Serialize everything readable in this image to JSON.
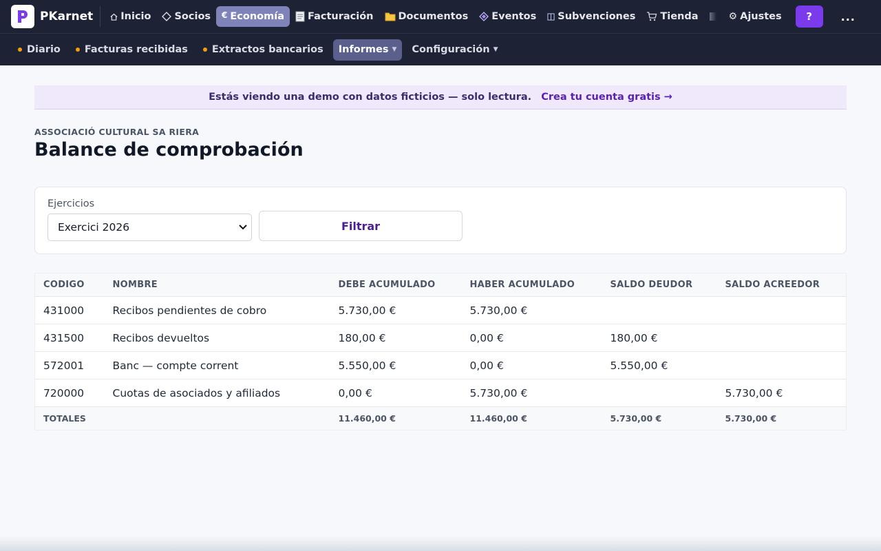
{
  "app": {
    "name": "PKarnet"
  },
  "nav": {
    "items": [
      {
        "label": "Inicio",
        "icon": "home-icon"
      },
      {
        "label": "Socios",
        "icon": "diamond-icon"
      },
      {
        "label": "Economía",
        "icon": "euro-icon",
        "active": true
      },
      {
        "label": "Facturación",
        "icon": "invoice-icon"
      },
      {
        "label": "Documentos",
        "icon": "folder-icon"
      },
      {
        "label": "Eventos",
        "icon": "event-diamond-icon"
      },
      {
        "label": "Subvenciones",
        "icon": "book-icon"
      },
      {
        "label": "Tienda",
        "icon": "cart-icon"
      }
    ],
    "settings_label": "Ajustes",
    "help_label": "?",
    "more_label": "..."
  },
  "subnav": {
    "items": [
      {
        "label": "Diario"
      },
      {
        "label": "Facturas recibidas"
      },
      {
        "label": "Extractos bancarios"
      },
      {
        "label": "Informes",
        "active": true
      },
      {
        "label": "Configuración"
      }
    ]
  },
  "banner": {
    "text": "Estás viendo una demo con datos ficticios — solo lectura.",
    "link": "Crea tu cuenta gratis →"
  },
  "page": {
    "org": "ASSOCIACIÓ CULTURAL SA RIERA",
    "title": "Balance de comprobación"
  },
  "filter": {
    "label": "Ejercicios",
    "selected": "Exercici 2026",
    "button": "Filtrar"
  },
  "table": {
    "headers": [
      "CODIGO",
      "NOMBRE",
      "DEBE ACUMULADO",
      "HABER ACUMULADO",
      "SALDO DEUDOR",
      "SALDO ACREEDOR"
    ],
    "rows": [
      [
        "431000",
        "Recibos pendientes de cobro",
        "5.730,00 €",
        "5.730,00 €",
        "",
        ""
      ],
      [
        "431500",
        "Recibos devueltos",
        "180,00 €",
        "0,00 €",
        "180,00 €",
        ""
      ],
      [
        "572001",
        "Banc — compte corrent",
        "5.550,00 €",
        "0,00 €",
        "5.550,00 €",
        ""
      ],
      [
        "720000",
        "Cuotas de asociados y afiliados",
        "0,00 €",
        "5.730,00 €",
        "",
        "5.730,00 €"
      ]
    ],
    "totals": [
      "TOTALES",
      "",
      "11.460,00 €",
      "11.460,00 €",
      "5.730,00 €",
      "5.730,00 €"
    ]
  },
  "colors": {
    "nav_bg": "#1e2235",
    "accent": "#7c3aed",
    "active_nav": "#7f84b8"
  }
}
